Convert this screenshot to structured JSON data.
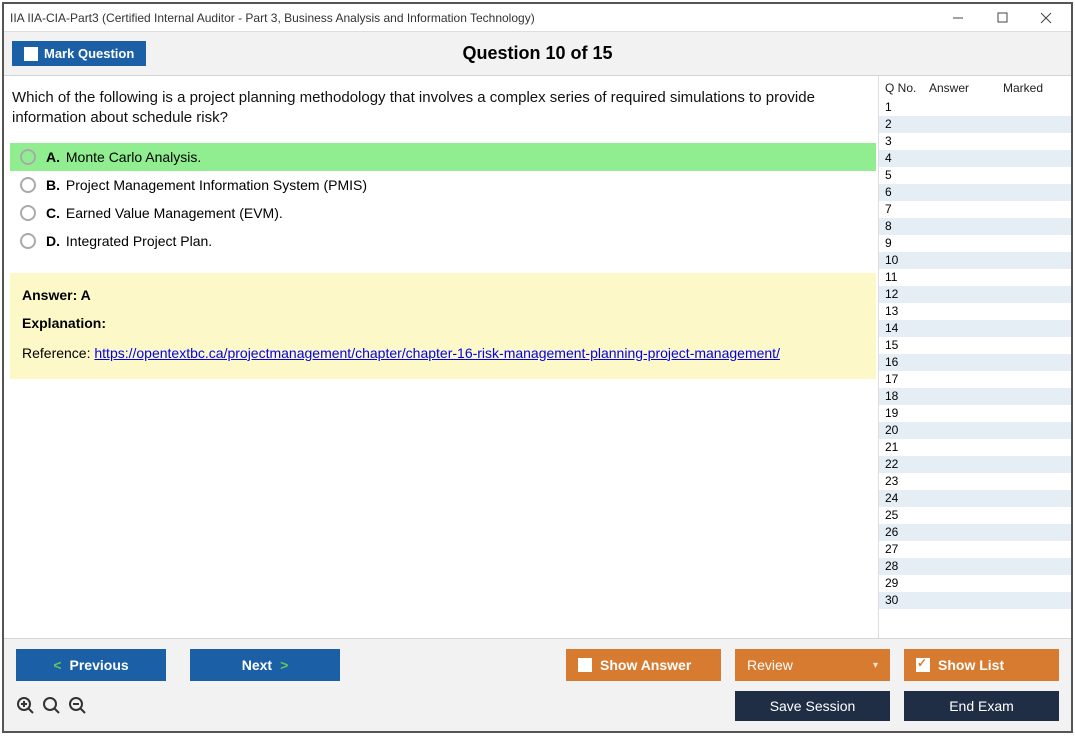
{
  "window": {
    "title": "IIA IIA-CIA-Part3 (Certified Internal Auditor - Part 3, Business Analysis and Information Technology)"
  },
  "header": {
    "mark_label": "Mark Question",
    "counter": "Question 10 of 15"
  },
  "question": {
    "text": "Which of the following is a project planning methodology that involves a complex series of required simulations to provide information about schedule risk?",
    "choices": [
      {
        "letter": "A.",
        "text": "Monte Carlo Analysis.",
        "correct": true
      },
      {
        "letter": "B.",
        "text": "Project Management Information System (PMIS)",
        "correct": false
      },
      {
        "letter": "C.",
        "text": "Earned Value Management (EVM).",
        "correct": false
      },
      {
        "letter": "D.",
        "text": "Integrated Project Plan.",
        "correct": false
      }
    ]
  },
  "answer": {
    "heading": "Answer: A",
    "explanation_label": "Explanation:",
    "reference_prefix": "Reference: ",
    "reference_link": "https://opentextbc.ca/projectmanagement/chapter/chapter-16-risk-management-planning-project-management/"
  },
  "sidebar": {
    "col_qno": "Q No.",
    "col_answer": "Answer",
    "col_marked": "Marked",
    "rows": [
      1,
      2,
      3,
      4,
      5,
      6,
      7,
      8,
      9,
      10,
      11,
      12,
      13,
      14,
      15,
      16,
      17,
      18,
      19,
      20,
      21,
      22,
      23,
      24,
      25,
      26,
      27,
      28,
      29,
      30
    ]
  },
  "footer": {
    "previous": "Previous",
    "next": "Next",
    "show_answer": "Show Answer",
    "review": "Review",
    "show_list": "Show List",
    "save_session": "Save Session",
    "end_exam": "End Exam"
  }
}
